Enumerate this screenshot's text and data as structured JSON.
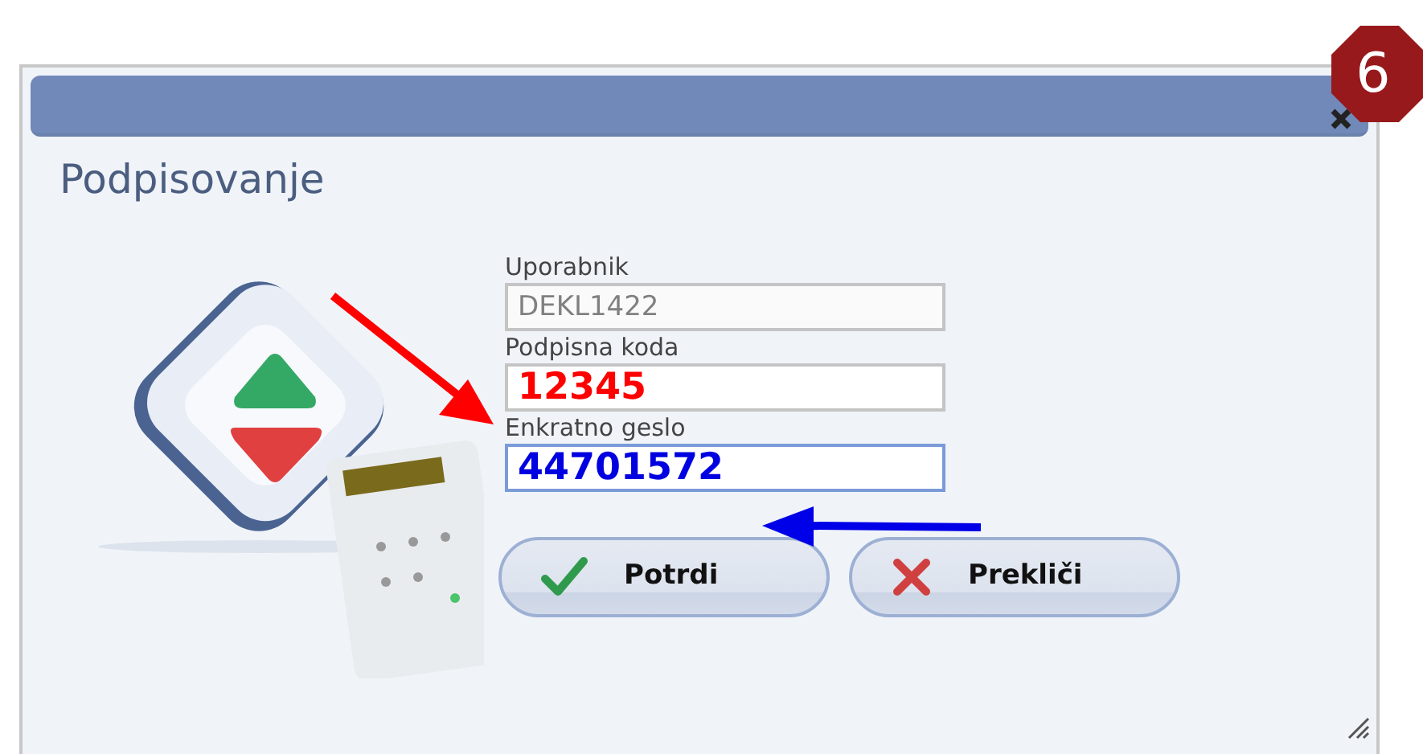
{
  "step_badge": "6",
  "dialog": {
    "title": "Podpisovanje",
    "fields": [
      {
        "label": "Uporabnik",
        "value": "DEKL1422",
        "disabled": true,
        "focused": false,
        "color": "#808080"
      },
      {
        "label": "Podpisna koda",
        "value": "12345",
        "disabled": false,
        "focused": false,
        "color": "#ff0000"
      },
      {
        "label": "Enkratno geslo",
        "value": "44701572",
        "disabled": false,
        "focused": true,
        "color": "#0000e0"
      }
    ],
    "buttons": [
      {
        "kind": "confirm",
        "label": "Potrdi"
      },
      {
        "kind": "cancel",
        "label": "Prekliči"
      }
    ]
  }
}
